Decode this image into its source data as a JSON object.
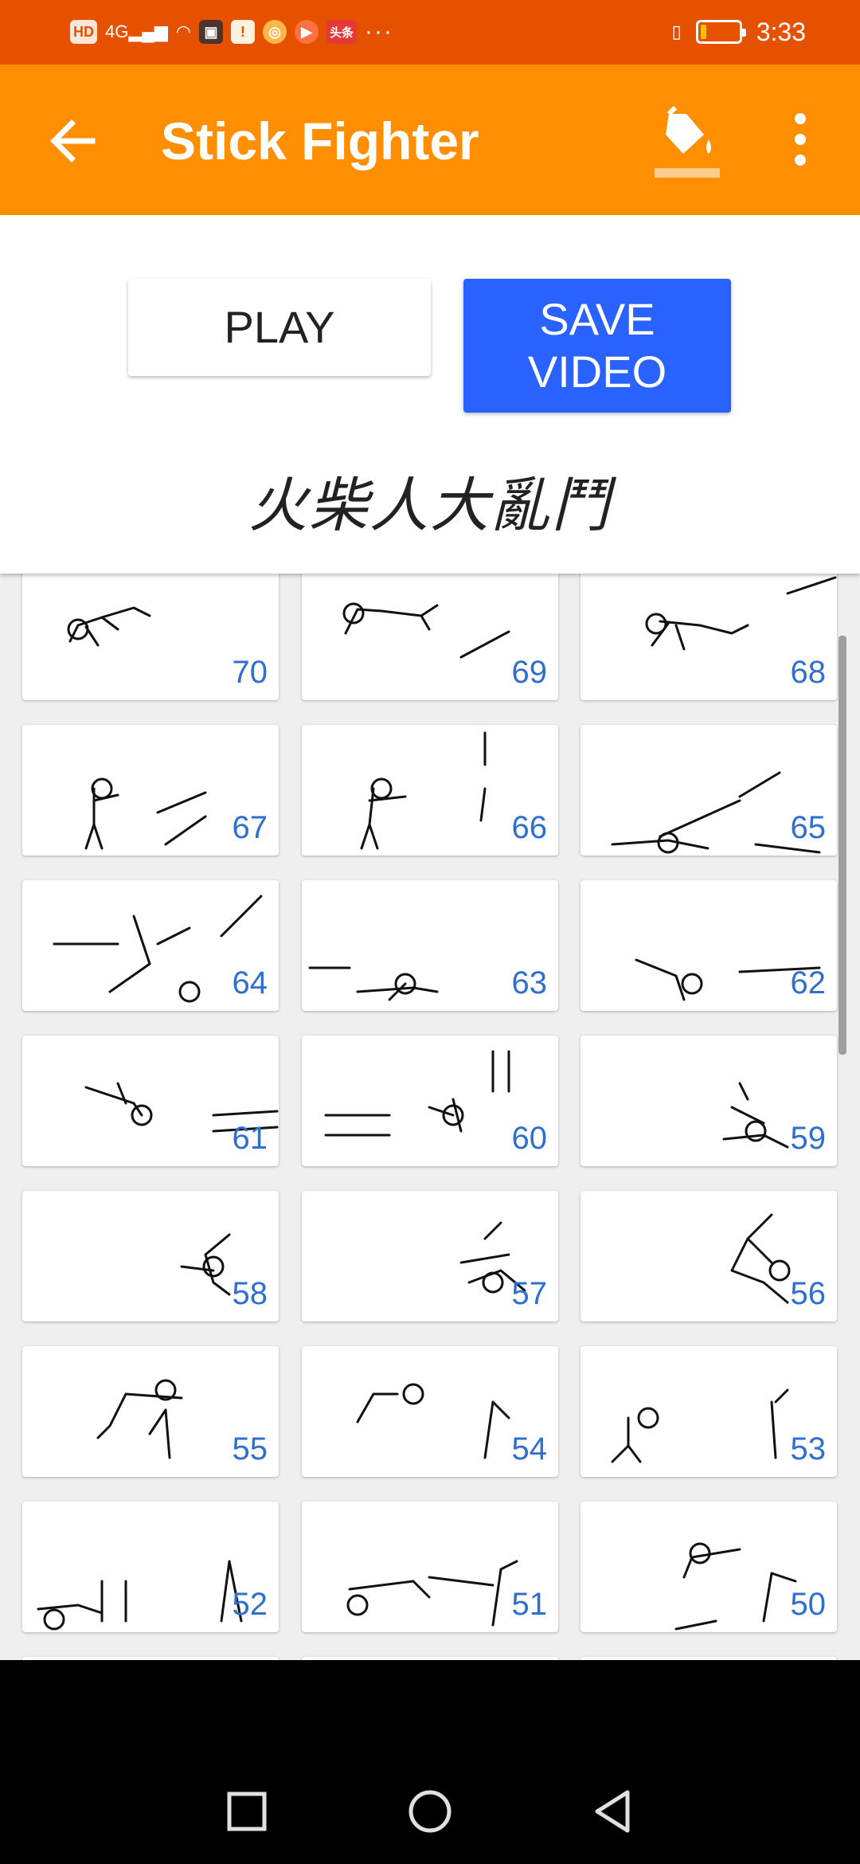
{
  "status_bar": {
    "left_icons": [
      "HD",
      "4G",
      "wifi-icon",
      "app-icon",
      "alert-icon",
      "app-icon",
      "video-icon",
      "news-icon"
    ],
    "hd_label": "HD",
    "network_label": "4G",
    "news_label": "头条",
    "more_dots": "···",
    "time": "3:33",
    "battery_level": 0.15
  },
  "app_bar": {
    "title": "Stick Fighter",
    "background": "#ff8f00",
    "status_color": "#e65100"
  },
  "controls": {
    "play_label": "PLAY",
    "save_label": "SAVE\nVIDEO",
    "save_color": "#2962ff",
    "logo_text": "火柴人大亂鬥"
  },
  "frames": [
    {
      "number": "70"
    },
    {
      "number": "69"
    },
    {
      "number": "68"
    },
    {
      "number": "67"
    },
    {
      "number": "66"
    },
    {
      "number": "65"
    },
    {
      "number": "64"
    },
    {
      "number": "63"
    },
    {
      "number": "62"
    },
    {
      "number": "61"
    },
    {
      "number": "60"
    },
    {
      "number": "59"
    },
    {
      "number": "58"
    },
    {
      "number": "57"
    },
    {
      "number": "56"
    },
    {
      "number": "55"
    },
    {
      "number": "54"
    },
    {
      "number": "53"
    },
    {
      "number": "52"
    },
    {
      "number": "51"
    },
    {
      "number": "50"
    }
  ],
  "nav_bar": {
    "icons": [
      "square-icon",
      "circle-icon",
      "triangle-back-icon"
    ]
  }
}
